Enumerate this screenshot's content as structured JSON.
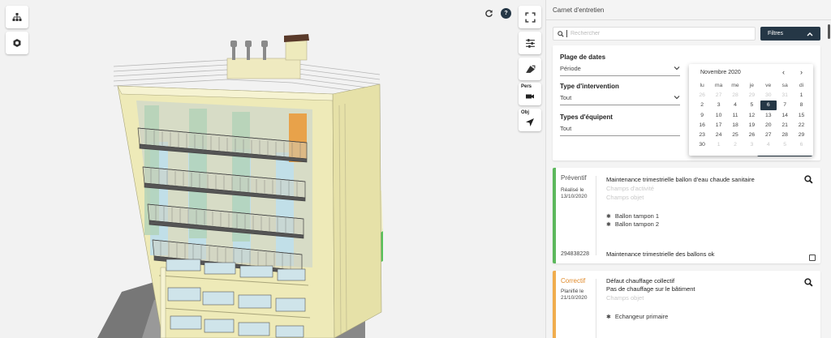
{
  "viewer": {
    "icons": {
      "hierarchy": "hierarchy-icon",
      "layers": "layers-icon",
      "refresh": "refresh-icon",
      "help": "help-icon",
      "fullscreen": "fullscreen-icon",
      "settings": "sliders-icon",
      "measure": "measure-icon",
      "camera": "camera-icon",
      "navigate": "navigation-arrow-icon"
    },
    "help_label": "?",
    "pers_label": "Pers",
    "obj_label": "Obj"
  },
  "panel": {
    "title": "Carnet d'entretien",
    "search": {
      "placeholder": "Rechercher",
      "value": ""
    },
    "filters_label": "Filtres",
    "filters": {
      "date_range_label": "Plage de dates",
      "date_range_value": "Période",
      "intervention_label": "Type d'intervention",
      "intervention_value": "Tout",
      "equipment_label": "Types d'équipent",
      "equipment_value": "Tout"
    },
    "calendar": {
      "month": "Novembre 2020",
      "prev": "‹",
      "next": "›",
      "weekdays": [
        "lu",
        "ma",
        "me",
        "je",
        "ve",
        "sa",
        "di"
      ],
      "days": [
        {
          "d": "26",
          "o": true
        },
        {
          "d": "27",
          "o": true
        },
        {
          "d": "28",
          "o": true
        },
        {
          "d": "29",
          "o": true
        },
        {
          "d": "30",
          "o": true
        },
        {
          "d": "31",
          "o": true
        },
        {
          "d": "1"
        },
        {
          "d": "2"
        },
        {
          "d": "3"
        },
        {
          "d": "4"
        },
        {
          "d": "5"
        },
        {
          "d": "6",
          "s": true
        },
        {
          "d": "7"
        },
        {
          "d": "8"
        },
        {
          "d": "9"
        },
        {
          "d": "10"
        },
        {
          "d": "11"
        },
        {
          "d": "12"
        },
        {
          "d": "13"
        },
        {
          "d": "14"
        },
        {
          "d": "15"
        },
        {
          "d": "16"
        },
        {
          "d": "17"
        },
        {
          "d": "18"
        },
        {
          "d": "19"
        },
        {
          "d": "20"
        },
        {
          "d": "21"
        },
        {
          "d": "22"
        },
        {
          "d": "23"
        },
        {
          "d": "24"
        },
        {
          "d": "25"
        },
        {
          "d": "26"
        },
        {
          "d": "27"
        },
        {
          "d": "28"
        },
        {
          "d": "29"
        },
        {
          "d": "30"
        },
        {
          "d": "1",
          "o": true
        },
        {
          "d": "2",
          "o": true
        },
        {
          "d": "3",
          "o": true
        },
        {
          "d": "4",
          "o": true
        },
        {
          "d": "5",
          "o": true
        },
        {
          "d": "6",
          "o": true
        }
      ]
    },
    "records": [
      {
        "type": "Préventif",
        "type_color": "#5cb85c",
        "status": "Réalisé le",
        "date": "13/10/2020",
        "title": "Maintenance trimestrielle ballon d'eau chaude sanitaire",
        "activity_placeholder": "Champs d'activité",
        "object_placeholder": "Champs objet",
        "equipments": [
          "Ballon tampon 1",
          "Ballon tampon 2"
        ],
        "reference": "294838228",
        "comment": "Maintenance trimestrielle des ballons ok"
      },
      {
        "type": "Correctif",
        "type_color": "#f0ad4e",
        "status": "Planifié le",
        "date": "21/10/2020",
        "title": "Défaut chauffage collectif",
        "subtitle": "Pas de chauffage sur le bâtiment",
        "object_placeholder": "Champs objet",
        "equipments": [
          "Echangeur primaire"
        ]
      }
    ]
  }
}
